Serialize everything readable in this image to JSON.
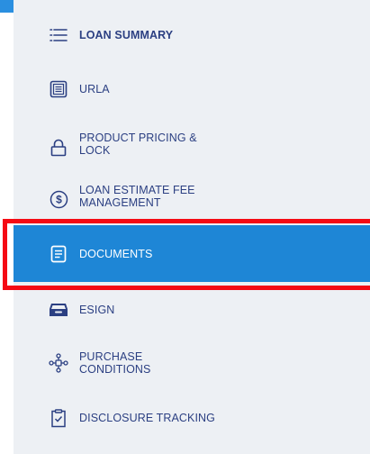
{
  "sidebar": {
    "items": [
      {
        "label": "LOAN SUMMARY",
        "icon": "list-icon",
        "bold": true
      },
      {
        "label": "URLA",
        "icon": "form-icon"
      },
      {
        "label": "PRODUCT PRICING & LOCK",
        "line1": "PRODUCT PRICING &",
        "line2": "LOCK",
        "icon": "lock-icon"
      },
      {
        "label": "LOAN ESTIMATE FEE MANAGEMENT",
        "line1": "LOAN ESTIMATE FEE",
        "line2": "MANAGEMENT",
        "icon": "dollar-circle-icon"
      },
      {
        "label": "DOCUMENTS",
        "icon": "document-icon",
        "active": true
      },
      {
        "label": "ESIGN",
        "icon": "inbox-tray-icon"
      },
      {
        "label": "PURCHASE CONDITIONS",
        "line1": "PURCHASE",
        "line2": "CONDITIONS",
        "icon": "network-icon"
      },
      {
        "label": "DISCLOSURE TRACKING",
        "icon": "clipboard-check-icon"
      }
    ]
  },
  "colors": {
    "sidebar_bg": "#edf0f4",
    "text": "#2b3f82",
    "active_bg": "#1e86d6",
    "highlight_border": "#f50a14",
    "corner_accent": "#2a8fe0"
  }
}
